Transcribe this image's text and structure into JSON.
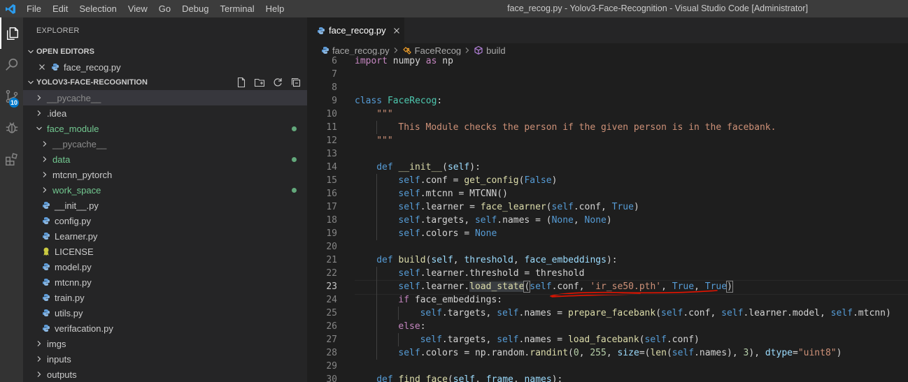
{
  "window": {
    "title": "face_recog.py - Yolov3-Face-Recognition - Visual Studio Code [Administrator]",
    "menu": [
      "File",
      "Edit",
      "Selection",
      "View",
      "Go",
      "Debug",
      "Terminal",
      "Help"
    ]
  },
  "activity_bar": {
    "items": [
      "explorer-icon",
      "search-icon",
      "source-control-icon",
      "debug-icon",
      "extensions-icon"
    ],
    "scm_badge": "10"
  },
  "sidebar": {
    "title": "EXPLORER",
    "open_editors": {
      "label": "OPEN EDITORS",
      "items": [
        {
          "name": "face_recog.py"
        }
      ]
    },
    "project": {
      "label": "YOLOV3-FACE-RECOGNITION",
      "items": [
        {
          "name": "__pycache__",
          "type": "folder",
          "depth": 0,
          "status": "dim"
        },
        {
          "name": ".idea",
          "type": "folder",
          "depth": 0,
          "status": ""
        },
        {
          "name": "face_module",
          "type": "folder-open",
          "depth": 0,
          "status": "modified"
        },
        {
          "name": "__pycache__",
          "type": "folder",
          "depth": 1,
          "status": "dim"
        },
        {
          "name": "data",
          "type": "folder",
          "depth": 1,
          "status": "modified"
        },
        {
          "name": "mtcnn_pytorch",
          "type": "folder",
          "depth": 1,
          "status": ""
        },
        {
          "name": "work_space",
          "type": "folder",
          "depth": 1,
          "status": "modified"
        },
        {
          "name": "__init__.py",
          "type": "py",
          "depth": 1,
          "status": ""
        },
        {
          "name": "config.py",
          "type": "py",
          "depth": 1,
          "status": ""
        },
        {
          "name": "Learner.py",
          "type": "py",
          "depth": 1,
          "status": ""
        },
        {
          "name": "LICENSE",
          "type": "license",
          "depth": 1,
          "status": ""
        },
        {
          "name": "model.py",
          "type": "py",
          "depth": 1,
          "status": ""
        },
        {
          "name": "mtcnn.py",
          "type": "py",
          "depth": 1,
          "status": ""
        },
        {
          "name": "train.py",
          "type": "py",
          "depth": 1,
          "status": ""
        },
        {
          "name": "utils.py",
          "type": "py",
          "depth": 1,
          "status": ""
        },
        {
          "name": "verifacation.py",
          "type": "py",
          "depth": 1,
          "status": ""
        },
        {
          "name": "imgs",
          "type": "folder",
          "depth": 0,
          "status": ""
        },
        {
          "name": "inputs",
          "type": "folder",
          "depth": 0,
          "status": ""
        },
        {
          "name": "outputs",
          "type": "folder",
          "depth": 0,
          "status": ""
        }
      ]
    }
  },
  "tabs": [
    {
      "label": "face_recog.py",
      "active": true
    }
  ],
  "breadcrumb": [
    "face_recog.py",
    "FaceRecog",
    "build"
  ],
  "editor": {
    "current_line": 23,
    "lines": [
      {
        "n": "6",
        "indent": 0,
        "tokens": [
          [
            "kc",
            "import"
          ],
          [
            "txt",
            " numpy "
          ],
          [
            "kc",
            "as"
          ],
          [
            "txt",
            " np"
          ]
        ]
      },
      {
        "n": "7",
        "indent": 0,
        "tokens": []
      },
      {
        "n": "8",
        "indent": 0,
        "tokens": []
      },
      {
        "n": "9",
        "indent": 0,
        "tokens": [
          [
            "kw",
            "class"
          ],
          [
            "txt",
            " "
          ],
          [
            "cls",
            "FaceRecog"
          ],
          [
            "txt",
            ":"
          ]
        ]
      },
      {
        "n": "10",
        "indent": 1,
        "tokens": [
          [
            "str",
            "\"\"\""
          ]
        ]
      },
      {
        "n": "11",
        "indent": 2,
        "tokens": [
          [
            "str",
            "This Module checks the person if the given person is in the facebank."
          ]
        ]
      },
      {
        "n": "12",
        "indent": 1,
        "tokens": [
          [
            "str",
            "\"\"\""
          ]
        ]
      },
      {
        "n": "13",
        "indent": 0,
        "tokens": []
      },
      {
        "n": "14",
        "indent": 1,
        "tokens": [
          [
            "kw",
            "def"
          ],
          [
            "txt",
            " "
          ],
          [
            "fn",
            "__init__"
          ],
          [
            "txt",
            "("
          ],
          [
            "prm",
            "self"
          ],
          [
            "txt",
            "):"
          ]
        ]
      },
      {
        "n": "15",
        "indent": 2,
        "tokens": [
          [
            "kw",
            "self"
          ],
          [
            "txt",
            ".conf = "
          ],
          [
            "fn",
            "get_config"
          ],
          [
            "txt",
            "("
          ],
          [
            "kw",
            "False"
          ],
          [
            "txt",
            ")"
          ]
        ]
      },
      {
        "n": "16",
        "indent": 2,
        "tokens": [
          [
            "kw",
            "self"
          ],
          [
            "txt",
            ".mtcnn = MTCNN()"
          ]
        ]
      },
      {
        "n": "17",
        "indent": 2,
        "tokens": [
          [
            "kw",
            "self"
          ],
          [
            "txt",
            ".learner = "
          ],
          [
            "fn",
            "face_learner"
          ],
          [
            "txt",
            "("
          ],
          [
            "kw",
            "self"
          ],
          [
            "txt",
            ".conf, "
          ],
          [
            "kw",
            "True"
          ],
          [
            "txt",
            ")"
          ]
        ]
      },
      {
        "n": "18",
        "indent": 2,
        "tokens": [
          [
            "kw",
            "self"
          ],
          [
            "txt",
            ".targets, "
          ],
          [
            "kw",
            "self"
          ],
          [
            "txt",
            ".names = ("
          ],
          [
            "kw",
            "None"
          ],
          [
            "txt",
            ", "
          ],
          [
            "kw",
            "None"
          ],
          [
            "txt",
            ")"
          ]
        ]
      },
      {
        "n": "19",
        "indent": 2,
        "tokens": [
          [
            "kw",
            "self"
          ],
          [
            "txt",
            ".colors = "
          ],
          [
            "kw",
            "None"
          ]
        ]
      },
      {
        "n": "20",
        "indent": 0,
        "tokens": []
      },
      {
        "n": "21",
        "indent": 1,
        "tokens": [
          [
            "kw",
            "def"
          ],
          [
            "txt",
            " "
          ],
          [
            "fn",
            "build"
          ],
          [
            "txt",
            "("
          ],
          [
            "prm",
            "self"
          ],
          [
            "txt",
            ", "
          ],
          [
            "prm",
            "threshold"
          ],
          [
            "txt",
            ", "
          ],
          [
            "prm",
            "face_embeddings"
          ],
          [
            "txt",
            "):"
          ]
        ]
      },
      {
        "n": "22",
        "indent": 2,
        "tokens": [
          [
            "kw",
            "self"
          ],
          [
            "txt",
            ".learner.threshold = threshold"
          ]
        ]
      },
      {
        "n": "23",
        "indent": 2,
        "tokens": [
          [
            "kw",
            "self"
          ],
          [
            "txt",
            ".learner."
          ],
          [
            "fn hl",
            "load_state"
          ],
          [
            "txt brk",
            "("
          ],
          [
            "kw",
            "self"
          ],
          [
            "txt",
            ".conf, "
          ],
          [
            "str",
            "'ir_se50.pth'"
          ],
          [
            "txt",
            ", "
          ],
          [
            "kw",
            "True"
          ],
          [
            "txt",
            ", "
          ],
          [
            "kw",
            "True"
          ],
          [
            "txt brk",
            ")"
          ]
        ]
      },
      {
        "n": "24",
        "indent": 2,
        "tokens": [
          [
            "kc",
            "if"
          ],
          [
            "txt",
            " face_embeddings:"
          ]
        ]
      },
      {
        "n": "25",
        "indent": 3,
        "tokens": [
          [
            "kw",
            "self"
          ],
          [
            "txt",
            ".targets, "
          ],
          [
            "kw",
            "self"
          ],
          [
            "txt",
            ".names = "
          ],
          [
            "fn",
            "prepare_facebank"
          ],
          [
            "txt",
            "("
          ],
          [
            "kw",
            "self"
          ],
          [
            "txt",
            ".conf, "
          ],
          [
            "kw",
            "self"
          ],
          [
            "txt",
            ".learner.model, "
          ],
          [
            "kw",
            "self"
          ],
          [
            "txt",
            ".mtcnn)"
          ]
        ]
      },
      {
        "n": "26",
        "indent": 2,
        "tokens": [
          [
            "kc",
            "else"
          ],
          [
            "txt",
            ":"
          ]
        ]
      },
      {
        "n": "27",
        "indent": 3,
        "tokens": [
          [
            "kw",
            "self"
          ],
          [
            "txt",
            ".targets, "
          ],
          [
            "kw",
            "self"
          ],
          [
            "txt",
            ".names = "
          ],
          [
            "fn",
            "load_facebank"
          ],
          [
            "txt",
            "("
          ],
          [
            "kw",
            "self"
          ],
          [
            "txt",
            ".conf)"
          ]
        ]
      },
      {
        "n": "28",
        "indent": 2,
        "tokens": [
          [
            "kw",
            "self"
          ],
          [
            "txt",
            ".colors = np.random."
          ],
          [
            "fn",
            "randint"
          ],
          [
            "txt",
            "("
          ],
          [
            "num",
            "0"
          ],
          [
            "txt",
            ", "
          ],
          [
            "num",
            "255"
          ],
          [
            "txt",
            ", "
          ],
          [
            "prm",
            "size"
          ],
          [
            "txt",
            "=("
          ],
          [
            "fn",
            "len"
          ],
          [
            "txt",
            "("
          ],
          [
            "kw",
            "self"
          ],
          [
            "txt",
            ".names), "
          ],
          [
            "num",
            "3"
          ],
          [
            "txt",
            "), "
          ],
          [
            "prm",
            "dtype"
          ],
          [
            "txt",
            "="
          ],
          [
            "str",
            "\"uint8\""
          ],
          [
            "txt",
            ")"
          ]
        ]
      },
      {
        "n": "29",
        "indent": 0,
        "tokens": []
      },
      {
        "n": "30",
        "indent": 1,
        "tokens": [
          [
            "kw",
            "def"
          ],
          [
            "txt",
            " "
          ],
          [
            "fn",
            "find_face"
          ],
          [
            "txt",
            "("
          ],
          [
            "prm",
            "self"
          ],
          [
            "txt",
            ", "
          ],
          [
            "prm",
            "frame"
          ],
          [
            "txt",
            ", "
          ],
          [
            "prm",
            "names"
          ],
          [
            "txt",
            "):"
          ]
        ]
      }
    ]
  },
  "colors": {
    "accent": "#007acc",
    "annotation": "#e51400",
    "modified": "#73c991"
  }
}
